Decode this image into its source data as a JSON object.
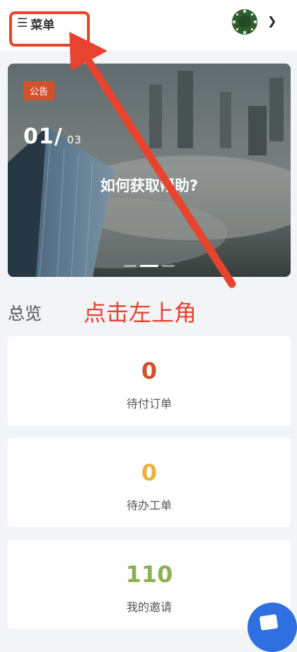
{
  "header": {
    "menu_icon": "hamburger-icon",
    "menu_label": "菜单",
    "avatar_icon": "avatar",
    "dropdown_icon": "chevron-down-icon"
  },
  "banner": {
    "tag": "公告",
    "current": "01/",
    "total": "03",
    "title": "如何获取帮助?",
    "slides": 3,
    "active_slide": 2
  },
  "overview": {
    "title": "总览",
    "annotation": "点击左上角"
  },
  "cards": [
    {
      "value": "0",
      "label": "待付订单",
      "color": "#d2512b"
    },
    {
      "value": "0",
      "label": "待办工单",
      "color": "#e9b23c"
    },
    {
      "value": "110",
      "label": "我的邀请",
      "color": "#8db054"
    }
  ],
  "colors": {
    "annotation_red": "#e8432e",
    "fab_blue": "#2f6fe0"
  }
}
